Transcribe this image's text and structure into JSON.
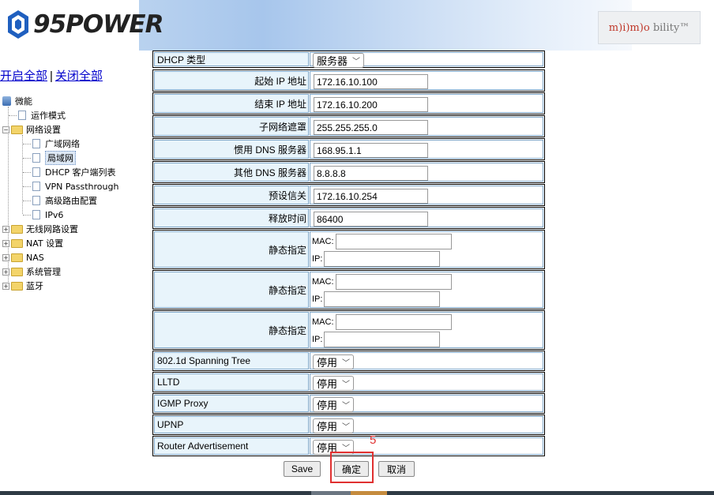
{
  "header": {
    "logo_text": "95POWER",
    "partner_logo": [
      "m",
      ")i",
      ")m",
      ")o",
      "bility",
      "™"
    ]
  },
  "toplinks": {
    "open_all": "开启全部",
    "separator": "|",
    "close_all": "关闭全部"
  },
  "tree": {
    "root": "微能",
    "items": [
      {
        "label": "运作模式"
      },
      {
        "label": "网络设置",
        "children": [
          "广域网络",
          "局域网",
          "DHCP 客户端列表",
          "VPN Passthrough",
          "高级路由配置",
          "IPv6"
        ],
        "selected": "局域网"
      },
      {
        "label": "无线网路设置"
      },
      {
        "label": "NAT 设置"
      },
      {
        "label": "NAS"
      },
      {
        "label": "系统管理"
      },
      {
        "label": "蓝牙"
      }
    ]
  },
  "form": {
    "dhcp_type": {
      "label": "DHCP 类型",
      "value": "服务器"
    },
    "start_ip": {
      "label": "起始 IP 地址",
      "value": "172.16.10.100"
    },
    "end_ip": {
      "label": "结束 IP 地址",
      "value": "172.16.10.200"
    },
    "subnet": {
      "label": "子网络遮罩",
      "value": "255.255.255.0"
    },
    "pref_dns": {
      "label": "惯用 DNS 服务器",
      "value": "168.95.1.1"
    },
    "other_dns": {
      "label": "其他 DNS 服务器",
      "value": "8.8.8.8"
    },
    "gateway": {
      "label": "预设信关",
      "value": "172.16.10.254"
    },
    "lease": {
      "label": "释放时间",
      "value": "86400"
    },
    "static": {
      "label": "静态指定",
      "mac_label": "MAC:",
      "ip_label": "IP:"
    },
    "stp": {
      "label": "802.1d Spanning Tree",
      "value": "停用"
    },
    "lltd": {
      "label": "LLTD",
      "value": "停用"
    },
    "igmp": {
      "label": "IGMP Proxy",
      "value": "停用"
    },
    "upnp": {
      "label": "UPNP",
      "value": "停用"
    },
    "radv": {
      "label": "Router Advertisement",
      "value": "停用"
    }
  },
  "buttons": {
    "save": "Save",
    "confirm": "确定",
    "cancel": "取消"
  },
  "annotation": {
    "step": "5",
    "color": "#e03030"
  }
}
